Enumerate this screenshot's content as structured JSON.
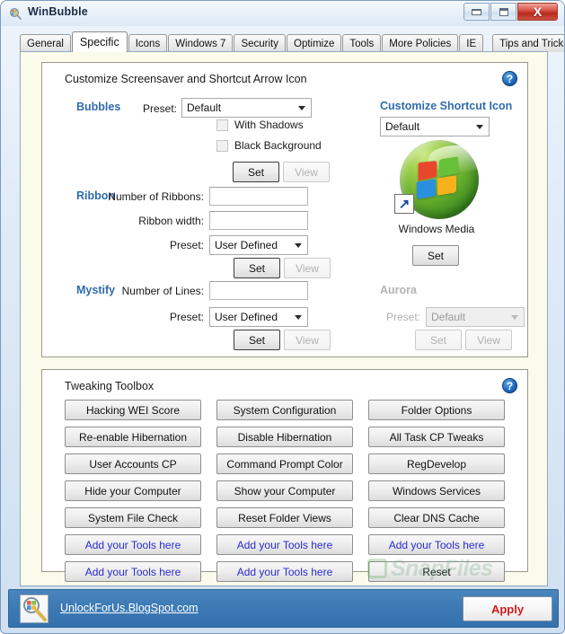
{
  "window": {
    "title": "WinBubble",
    "icon": "app-magnifier-icon",
    "buttons": {
      "minimize": "minimize-icon",
      "maximize": "maximize-icon",
      "close": "X"
    }
  },
  "tabs": [
    {
      "label": "General",
      "active": false
    },
    {
      "label": "Specific",
      "active": true
    },
    {
      "label": "Icons",
      "active": false
    },
    {
      "label": "Windows 7",
      "active": false
    },
    {
      "label": "Security",
      "active": false
    },
    {
      "label": "Optimize",
      "active": false
    },
    {
      "label": "Tools",
      "active": false
    },
    {
      "label": "More Policies",
      "active": false
    },
    {
      "label": "IE",
      "active": false
    },
    {
      "label": "Tips and Tricks",
      "active": false
    }
  ],
  "screensaver_group": {
    "title": "Customize Screensaver and Shortcut Arrow Icon",
    "help": "?",
    "bubbles": {
      "heading": "Bubbles",
      "preset_label": "Preset:",
      "preset_value": "Default",
      "with_shadows_label": "With Shadows",
      "black_background_label": "Black Background",
      "set_label": "Set",
      "view_label": "View"
    },
    "ribbon": {
      "heading": "Ribbon",
      "number_label": "Number of Ribbons:",
      "number_value": "",
      "width_label": "Ribbon width:",
      "width_value": "",
      "preset_label": "Preset:",
      "preset_value": "User Defined",
      "set_label": "Set",
      "view_label": "View"
    },
    "mystify": {
      "heading": "Mystify",
      "lines_label": "Number of Lines:",
      "lines_value": "",
      "preset_label": "Preset:",
      "preset_value": "User Defined",
      "set_label": "Set",
      "view_label": "View"
    },
    "shortcut_icon": {
      "heading": "Customize Shortcut Icon",
      "combo_value": "Default",
      "preview_caption": "Windows Media",
      "preview_badge": "↗",
      "set_label": "Set"
    },
    "aurora": {
      "heading": "Aurora",
      "preset_label": "Preset:",
      "preset_value": "Default",
      "set_label": "Set",
      "view_label": "View",
      "disabled": true
    }
  },
  "toolbox_group": {
    "title": "Tweaking Toolbox",
    "help": "?",
    "columns": [
      [
        {
          "label": "Hacking WEI Score",
          "style": "normal"
        },
        {
          "label": "Re-enable Hibernation",
          "style": "normal"
        },
        {
          "label": "User Accounts CP",
          "style": "normal"
        },
        {
          "label": "Hide your Computer",
          "style": "normal"
        },
        {
          "label": "System File Check",
          "style": "normal"
        },
        {
          "label": "Add your Tools here",
          "style": "blue"
        },
        {
          "label": "Add your Tools here",
          "style": "blue"
        }
      ],
      [
        {
          "label": "System Configuration",
          "style": "normal"
        },
        {
          "label": "Disable Hibernation",
          "style": "normal"
        },
        {
          "label": "Command Prompt Color",
          "style": "normal"
        },
        {
          "label": "Show your Computer",
          "style": "normal"
        },
        {
          "label": "Reset Folder Views",
          "style": "normal"
        },
        {
          "label": "Add your Tools here",
          "style": "blue"
        },
        {
          "label": "Add your Tools here",
          "style": "blue"
        }
      ],
      [
        {
          "label": "Folder Options",
          "style": "normal"
        },
        {
          "label": "All Task CP Tweaks",
          "style": "normal"
        },
        {
          "label": "RegDevelop",
          "style": "normal"
        },
        {
          "label": "Windows Services",
          "style": "normal"
        },
        {
          "label": "Clear DNS Cache",
          "style": "normal"
        },
        {
          "label": "Add your Tools here",
          "style": "blue"
        },
        {
          "label": "Reset",
          "style": "normal"
        }
      ]
    ]
  },
  "statusbar": {
    "icon": "app-magnifier-icon",
    "link": "UnlockForUs.BlogSpot.com",
    "apply_label": "Apply"
  },
  "watermark": {
    "text": "SnapFiles"
  },
  "colors": {
    "accent_blue": "#2f6bad",
    "frame_blue": "#3c79b4",
    "client_bg": "#fbfbeb",
    "apply_red": "#d01c1c",
    "blue_button_text": "#2b2bd0"
  }
}
